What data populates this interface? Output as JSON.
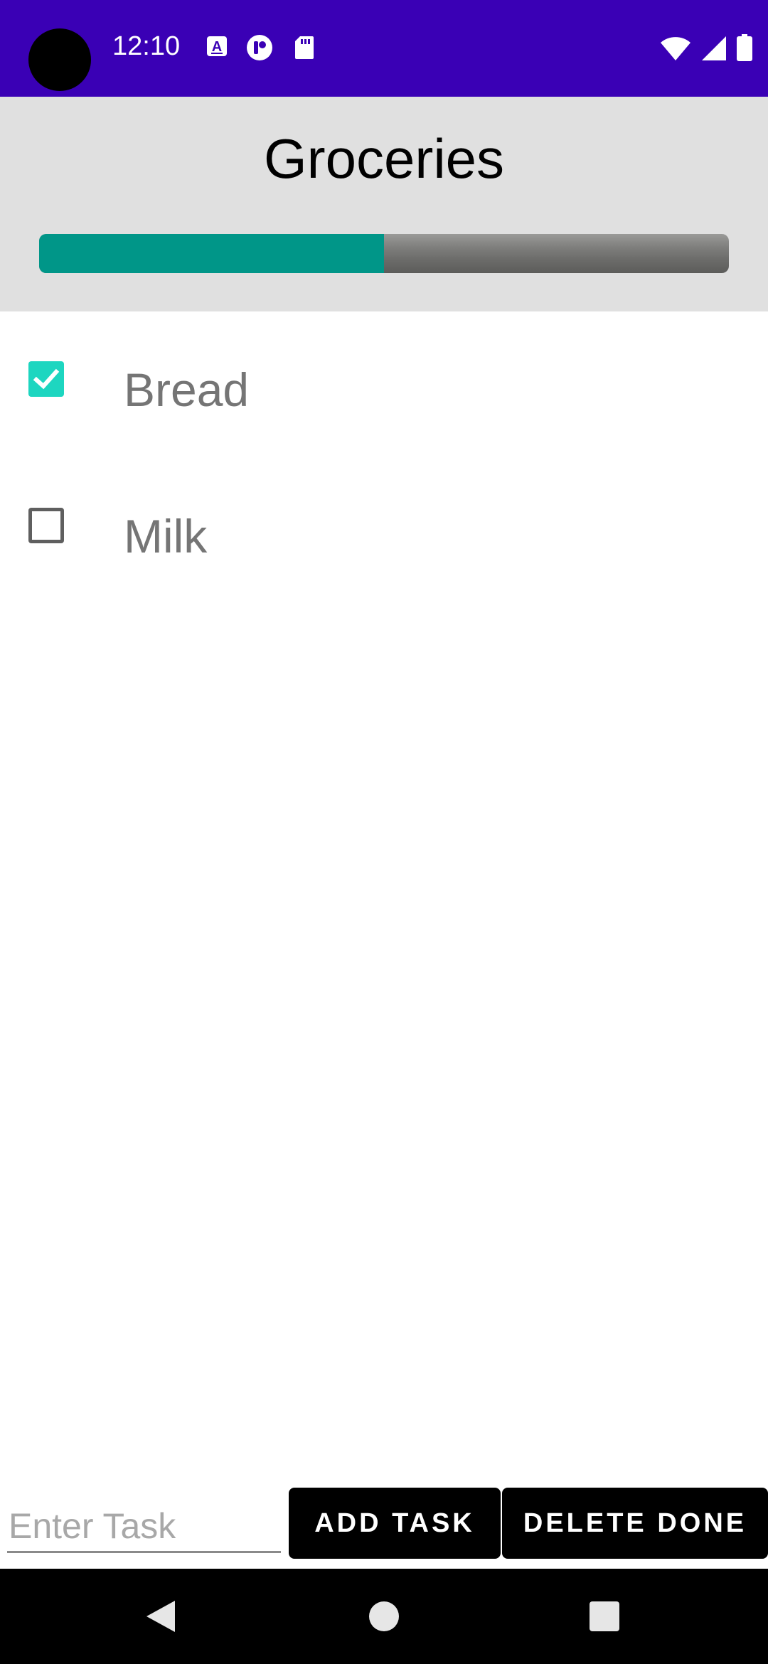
{
  "status_bar": {
    "time": "12:10",
    "left_icons": [
      "a-notification-icon",
      "app-notification-icon",
      "sd-card-icon"
    ],
    "right_icons": [
      "wifi-icon",
      "signal-icon",
      "battery-icon"
    ],
    "background_color": "#3a00b5"
  },
  "header": {
    "title": "Groceries",
    "progress": 0.5,
    "progress_color": "#009688"
  },
  "tasks": [
    {
      "label": "Bread",
      "checked": true
    },
    {
      "label": "Milk",
      "checked": false
    }
  ],
  "input": {
    "placeholder": "Enter Task",
    "value": ""
  },
  "buttons": {
    "add_label": "ADD TASK",
    "delete_label": "DELETE DONE"
  },
  "nav": {
    "icons": [
      "back-icon",
      "home-icon",
      "recents-icon"
    ]
  }
}
